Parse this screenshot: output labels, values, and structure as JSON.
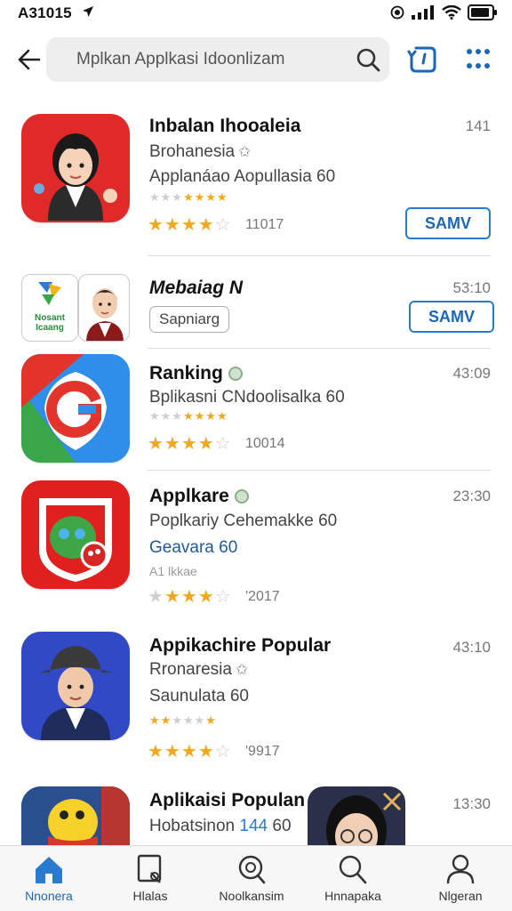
{
  "status_bar": {
    "time": "A31015"
  },
  "search": {
    "query": "Mplkan Applkasi Idoonlizam"
  },
  "apps": [
    {
      "name": "Inbalan Ihooaleia",
      "subtitle": "Brohanesia",
      "subtitle2": "Applanáao Aopullasia 60",
      "time": "141",
      "rating_stars": 4.5,
      "rating_count": "11017",
      "action": "SAMV"
    },
    {
      "name": "Mebaiag N",
      "icon_text_1": "Nosant",
      "icon_text_2": "Icaang",
      "chip": "Sapniarg",
      "time": "53:10",
      "action": "SAMV"
    },
    {
      "name": "Ranking",
      "subtitle": "Bplikasni CNdoolisalka 60",
      "time": "43:09",
      "rating_stars": 4.5,
      "rating_count": "10014"
    },
    {
      "name": "Applkare",
      "subtitle": "Poplkariy Cehemakke 60",
      "subtitle2": "Geavara 60",
      "small_text": "A1 lkkae",
      "time": "23:30",
      "rating_stars": 3.5,
      "rating_count": "'2017"
    },
    {
      "name": "Appikachire Popular",
      "subtitle": "Rronaresia",
      "subtitle2": "Saunulata 60",
      "time": "43:10",
      "rating_stars": 4,
      "rating_count": "'9917"
    },
    {
      "name": "Aplikaisi Populan",
      "subtitle": "Hobatsinon",
      "subtitle_highlight": "144",
      "subtitle_end": "60",
      "time": "13:30"
    }
  ],
  "bottom_nav": [
    {
      "label": "Nnonera",
      "icon": "home-icon",
      "active": true
    },
    {
      "label": "Hlalas",
      "icon": "gallery-icon",
      "active": false
    },
    {
      "label": "Noolkansim",
      "icon": "search-badge-icon",
      "active": false
    },
    {
      "label": "Hnnapaka",
      "icon": "search-icon",
      "active": false
    },
    {
      "label": "Nlgeran",
      "icon": "person-icon",
      "active": false
    }
  ],
  "colors": {
    "accent_blue": "#1c66b8",
    "star_gold": "#f2a81e",
    "icon1_bg": "#e02a2a",
    "icon3_bg": "#2f8ee8",
    "icon4_bg": "#e01f1f",
    "icon5_bg": "#3149c4"
  }
}
